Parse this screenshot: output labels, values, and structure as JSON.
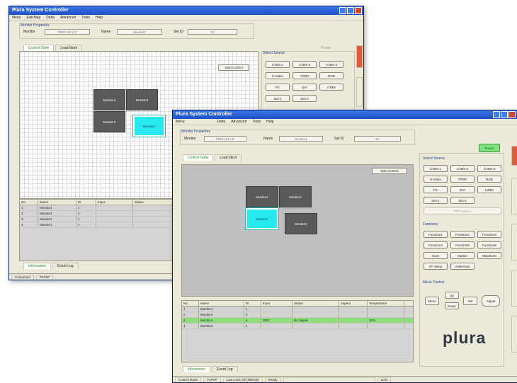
{
  "app_title": "Plura System Controller",
  "menus_back": [
    "Menu",
    "Edit Map",
    "Delta",
    "Advanced",
    "Tools",
    "Help"
  ],
  "menus_front": [
    "Menu",
    "",
    "Delta",
    "Advanced",
    "Tools",
    "Help"
  ],
  "monitor_properties": {
    "title": "Monitor Properties",
    "monitor_label": "Monitor",
    "monitor_value": "PBM-191 LD",
    "name_label": "Name",
    "name_value": "Monitor1",
    "set_id_label": "Set ID",
    "set_id_value": "01"
  },
  "tabs": [
    "Control Table",
    "Load Ident"
  ],
  "start_control": "Start Control",
  "power_button": "Power",
  "monitors_back": [
    "Monitor4",
    "Monitor3",
    "Monitor2",
    "Monitor1"
  ],
  "monitors_front": [
    "Monitor4",
    "Monitor3",
    "Monitor1",
    "Monitor2"
  ],
  "select_source": {
    "title": "Select Source",
    "buttons": [
      "CVBS-1",
      "CVBS-2",
      "CVBS-3",
      "S-Video",
      "YPbPr",
      "RGB",
      "PC",
      "DVI",
      "HDMI",
      "SDI-1",
      "SDI-2"
    ],
    "pip": "PIP Position"
  },
  "functions": {
    "title": "Functions",
    "buttons": [
      "Function1",
      "Function2",
      "Function3",
      "Function4",
      "Function5",
      "Function6",
      "Scan",
      "Marker",
      "Waveform",
      "I/O Setup",
      "Underscan"
    ]
  },
  "menu_control": {
    "title": "Menu Control",
    "menu": "Menu",
    "up": "Up",
    "down": "Down",
    "set": "Set",
    "adjust": "Adjust"
  },
  "table": {
    "headers_back": [
      "No.",
      "Name",
      "ID",
      "Input",
      "Status"
    ],
    "rows_back": [
      [
        "1",
        "Monitor4",
        "1",
        "",
        ""
      ],
      [
        "2",
        "Monitor3",
        "2",
        "",
        ""
      ],
      [
        "3",
        "Monitor2",
        "3",
        "",
        ""
      ],
      [
        "4",
        "Monitor1",
        "4",
        "",
        ""
      ]
    ],
    "headers_front": [
      "No.",
      "Name",
      "ID",
      "Input",
      "Status",
      "Aspect",
      "Temperature"
    ],
    "rows_front": [
      [
        "1",
        "Monitor4",
        "1",
        "",
        "",
        "",
        ""
      ],
      [
        "2",
        "Monitor3",
        "2",
        "",
        "",
        "",
        ""
      ],
      [
        "3",
        "Monitor1",
        "3",
        "SDI1",
        "No Signal",
        "",
        "39.5"
      ],
      [
        "4",
        "Monitor2",
        "4",
        "",
        "",
        "",
        ""
      ]
    ]
  },
  "bottom_tabs": [
    "Information",
    "Event Log"
  ],
  "status_back": [
    "Connected",
    "TCP/IP"
  ],
  "status_front": [
    "Control Mode",
    "TCP/IP",
    "Last Cmd: Ok (Idle/Ok)",
    "Ready",
    "",
    "LOG"
  ],
  "logo": "plura"
}
